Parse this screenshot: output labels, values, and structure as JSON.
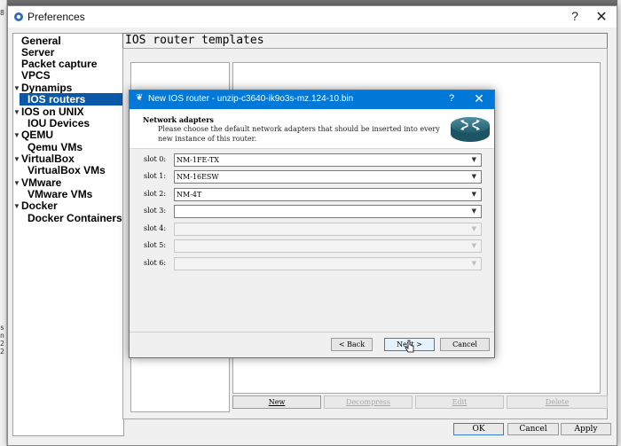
{
  "preferences": {
    "title": "Preferences",
    "help_label": "?",
    "close_label": "✕"
  },
  "tree": {
    "items": [
      {
        "label": "General",
        "expander": ""
      },
      {
        "label": "Server",
        "expander": ""
      },
      {
        "label": "Packet capture",
        "expander": ""
      },
      {
        "label": "VPCS",
        "expander": ""
      },
      {
        "label": "Dynamips",
        "expander": "▼"
      },
      {
        "label": "IOS routers",
        "expander": ""
      },
      {
        "label": "IOS on UNIX",
        "expander": "▼"
      },
      {
        "label": "IOU Devices",
        "expander": ""
      },
      {
        "label": "QEMU",
        "expander": "▼"
      },
      {
        "label": "Qemu VMs",
        "expander": ""
      },
      {
        "label": "VirtualBox",
        "expander": "▼"
      },
      {
        "label": "VirtualBox VMs",
        "expander": ""
      },
      {
        "label": "VMware",
        "expander": "▼"
      },
      {
        "label": "VMware VMs",
        "expander": ""
      },
      {
        "label": "Docker",
        "expander": "▼"
      },
      {
        "label": "Docker Containers",
        "expander": ""
      }
    ],
    "selected": "IOS routers"
  },
  "page": {
    "title": "IOS router templates",
    "buttons": {
      "new": "New",
      "decompress": "Decompress",
      "edit": "Edit",
      "delete": "Delete"
    }
  },
  "footer": {
    "ok": "OK",
    "cancel": "Cancel",
    "apply": "Apply"
  },
  "dialog": {
    "title": "New IOS router - unzip-c3640-ik9o3s-mz.124-10.bin",
    "help_label": "?",
    "close_label": "✕",
    "header_title": "Network adapters",
    "header_subtitle": "Please choose the default network adapters that should be inserted into every new instance of this router.",
    "slots": [
      {
        "label": "slot 0:",
        "value": "NM-1FE-TX",
        "enabled": true
      },
      {
        "label": "slot 1:",
        "value": "NM-16ESW",
        "enabled": true
      },
      {
        "label": "slot 2:",
        "value": "NM-4T",
        "enabled": true
      },
      {
        "label": "slot 3:",
        "value": "",
        "enabled": true
      },
      {
        "label": "slot 4:",
        "value": "",
        "enabled": false
      },
      {
        "label": "slot 5:",
        "value": "",
        "enabled": false
      },
      {
        "label": "slot 6:",
        "value": "",
        "enabled": false
      }
    ],
    "back_label": "< Back",
    "next_label": "Next >",
    "cancel_label": "Cancel"
  },
  "colors": {
    "selection": "#0a59a8",
    "dialog_titlebar": "#0078d7"
  }
}
